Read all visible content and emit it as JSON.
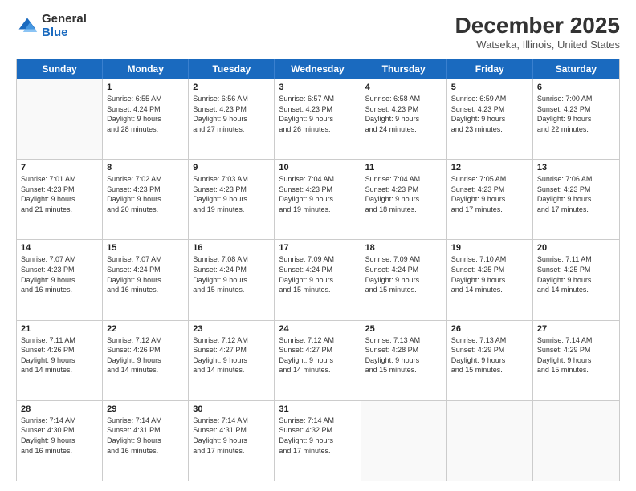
{
  "logo": {
    "general": "General",
    "blue": "Blue"
  },
  "title": "December 2025",
  "subtitle": "Watseka, Illinois, United States",
  "days_of_week": [
    "Sunday",
    "Monday",
    "Tuesday",
    "Wednesday",
    "Thursday",
    "Friday",
    "Saturday"
  ],
  "weeks": [
    [
      {
        "day": "",
        "info": ""
      },
      {
        "day": "1",
        "info": "Sunrise: 6:55 AM\nSunset: 4:24 PM\nDaylight: 9 hours\nand 28 minutes."
      },
      {
        "day": "2",
        "info": "Sunrise: 6:56 AM\nSunset: 4:23 PM\nDaylight: 9 hours\nand 27 minutes."
      },
      {
        "day": "3",
        "info": "Sunrise: 6:57 AM\nSunset: 4:23 PM\nDaylight: 9 hours\nand 26 minutes."
      },
      {
        "day": "4",
        "info": "Sunrise: 6:58 AM\nSunset: 4:23 PM\nDaylight: 9 hours\nand 24 minutes."
      },
      {
        "day": "5",
        "info": "Sunrise: 6:59 AM\nSunset: 4:23 PM\nDaylight: 9 hours\nand 23 minutes."
      },
      {
        "day": "6",
        "info": "Sunrise: 7:00 AM\nSunset: 4:23 PM\nDaylight: 9 hours\nand 22 minutes."
      }
    ],
    [
      {
        "day": "7",
        "info": "Sunrise: 7:01 AM\nSunset: 4:23 PM\nDaylight: 9 hours\nand 21 minutes."
      },
      {
        "day": "8",
        "info": "Sunrise: 7:02 AM\nSunset: 4:23 PM\nDaylight: 9 hours\nand 20 minutes."
      },
      {
        "day": "9",
        "info": "Sunrise: 7:03 AM\nSunset: 4:23 PM\nDaylight: 9 hours\nand 19 minutes."
      },
      {
        "day": "10",
        "info": "Sunrise: 7:04 AM\nSunset: 4:23 PM\nDaylight: 9 hours\nand 19 minutes."
      },
      {
        "day": "11",
        "info": "Sunrise: 7:04 AM\nSunset: 4:23 PM\nDaylight: 9 hours\nand 18 minutes."
      },
      {
        "day": "12",
        "info": "Sunrise: 7:05 AM\nSunset: 4:23 PM\nDaylight: 9 hours\nand 17 minutes."
      },
      {
        "day": "13",
        "info": "Sunrise: 7:06 AM\nSunset: 4:23 PM\nDaylight: 9 hours\nand 17 minutes."
      }
    ],
    [
      {
        "day": "14",
        "info": "Sunrise: 7:07 AM\nSunset: 4:23 PM\nDaylight: 9 hours\nand 16 minutes."
      },
      {
        "day": "15",
        "info": "Sunrise: 7:07 AM\nSunset: 4:24 PM\nDaylight: 9 hours\nand 16 minutes."
      },
      {
        "day": "16",
        "info": "Sunrise: 7:08 AM\nSunset: 4:24 PM\nDaylight: 9 hours\nand 15 minutes."
      },
      {
        "day": "17",
        "info": "Sunrise: 7:09 AM\nSunset: 4:24 PM\nDaylight: 9 hours\nand 15 minutes."
      },
      {
        "day": "18",
        "info": "Sunrise: 7:09 AM\nSunset: 4:24 PM\nDaylight: 9 hours\nand 15 minutes."
      },
      {
        "day": "19",
        "info": "Sunrise: 7:10 AM\nSunset: 4:25 PM\nDaylight: 9 hours\nand 14 minutes."
      },
      {
        "day": "20",
        "info": "Sunrise: 7:11 AM\nSunset: 4:25 PM\nDaylight: 9 hours\nand 14 minutes."
      }
    ],
    [
      {
        "day": "21",
        "info": "Sunrise: 7:11 AM\nSunset: 4:26 PM\nDaylight: 9 hours\nand 14 minutes."
      },
      {
        "day": "22",
        "info": "Sunrise: 7:12 AM\nSunset: 4:26 PM\nDaylight: 9 hours\nand 14 minutes."
      },
      {
        "day": "23",
        "info": "Sunrise: 7:12 AM\nSunset: 4:27 PM\nDaylight: 9 hours\nand 14 minutes."
      },
      {
        "day": "24",
        "info": "Sunrise: 7:12 AM\nSunset: 4:27 PM\nDaylight: 9 hours\nand 14 minutes."
      },
      {
        "day": "25",
        "info": "Sunrise: 7:13 AM\nSunset: 4:28 PM\nDaylight: 9 hours\nand 15 minutes."
      },
      {
        "day": "26",
        "info": "Sunrise: 7:13 AM\nSunset: 4:29 PM\nDaylight: 9 hours\nand 15 minutes."
      },
      {
        "day": "27",
        "info": "Sunrise: 7:14 AM\nSunset: 4:29 PM\nDaylight: 9 hours\nand 15 minutes."
      }
    ],
    [
      {
        "day": "28",
        "info": "Sunrise: 7:14 AM\nSunset: 4:30 PM\nDaylight: 9 hours\nand 16 minutes."
      },
      {
        "day": "29",
        "info": "Sunrise: 7:14 AM\nSunset: 4:31 PM\nDaylight: 9 hours\nand 16 minutes."
      },
      {
        "day": "30",
        "info": "Sunrise: 7:14 AM\nSunset: 4:31 PM\nDaylight: 9 hours\nand 17 minutes."
      },
      {
        "day": "31",
        "info": "Sunrise: 7:14 AM\nSunset: 4:32 PM\nDaylight: 9 hours\nand 17 minutes."
      },
      {
        "day": "",
        "info": ""
      },
      {
        "day": "",
        "info": ""
      },
      {
        "day": "",
        "info": ""
      }
    ]
  ]
}
